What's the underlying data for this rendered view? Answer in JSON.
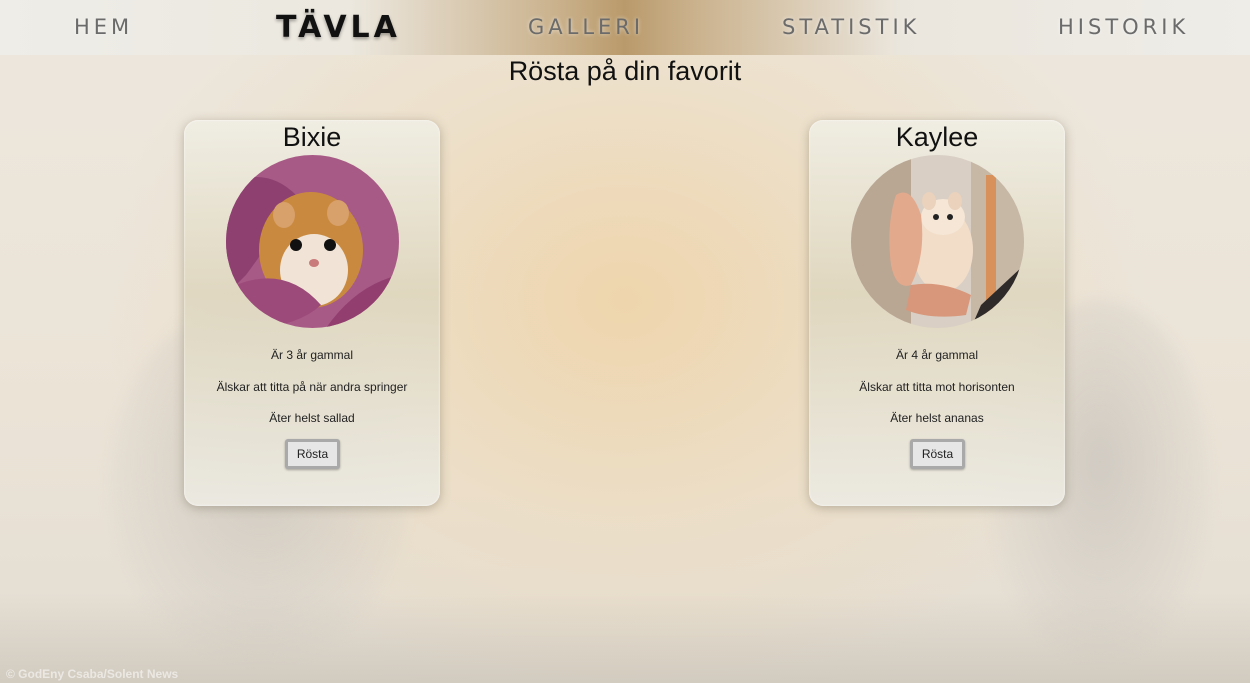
{
  "nav": {
    "items": [
      {
        "label": "HEM"
      },
      {
        "label": "TÄVLA"
      },
      {
        "label": "GALLERI"
      },
      {
        "label": "STATISTIK"
      },
      {
        "label": "HISTORIK"
      }
    ],
    "active": "TÄVLA"
  },
  "page": {
    "title": "Rösta på din favorit"
  },
  "cards": [
    {
      "name": "Bixie",
      "age": "Är 3 år gammal",
      "loves": "Älskar att titta på när andra springer",
      "eats": "Äter helst sallad",
      "vote_label": "Rösta"
    },
    {
      "name": "Kaylee",
      "age": "Är 4 år gammal",
      "loves": "Älskar att titta mot horisonten",
      "eats": "Äter helst ananas",
      "vote_label": "Rösta"
    }
  ],
  "footer": {
    "credit": "© GodEny Csaba/Solent News"
  }
}
